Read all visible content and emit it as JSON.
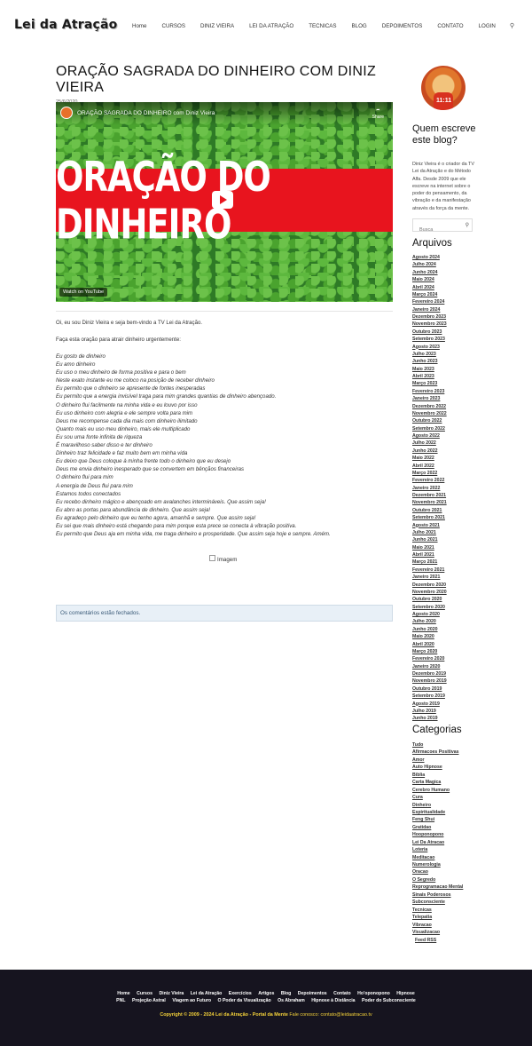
{
  "header": {
    "logo": "Lei da Atração",
    "nav": [
      "Home",
      "CURSOS",
      "DINIZ VIEIRA",
      "LEI DA ATRAÇÃO",
      "TECNICAS",
      "BLOG",
      "DEPOIMENTOS",
      "CONTATO",
      "LOGIN"
    ],
    "search_icon": "search-icon"
  },
  "post": {
    "title": "ORAÇÃO SAGRADA DO DINHEIRO COM DINIZ VIEIRA",
    "date": "25/6/2020",
    "video": {
      "title": "ORAÇÃO SAGRADA DO DINHEIRO com Diniz Vieira",
      "share": "Share",
      "banner": "ORAÇÃO DO DINHEIRO",
      "watch_on": "Watch on YouTube"
    },
    "intro1": "Oi, eu sou Diniz Vieira e seja bem-vindo a TV Lei da Atração.",
    "intro2": "Faça esta oração para atrair dinheiro urgentemente:",
    "prayer": [
      "Eu gosto de dinheiro",
      "Eu amo dinheiro",
      "Eu uso o meu dinheiro de forma positiva e para o bem",
      "Neste exato instante eu me coloco na posição de receber dinheiro",
      "Eu permito que o dinheiro se apresente de fontes inesperadas",
      "Eu permito que a energia invisível traga para mim grandes quantias de dinheiro abençoado.",
      "O dinheiro flui facilmente na minha vida e eu louvo por isso",
      "Eu uso dinheiro com alegria e ele sempre volta para mim",
      "Deus me recompense cada dia mais com dinheiro ilimitado",
      "Quanto mais eu uso meu dinheiro, mais ele multiplicado",
      "Eu sou uma fonte infinita de riqueza",
      "É maravilhoso saber disso e ter dinheiro",
      "Dinheiro traz felicidade e faz muito bem em minha vida",
      "Eu deixo que Deus coloque à minha frente todo o dinheiro que eu desejo",
      "Deus me envia dinheiro inesperado que se convertem em bênçãos financeiras",
      "O dinheiro flui para mim",
      "A energia de Deus flui para mim",
      "Estamos todos conectados",
      "Eu recebo dinheiro mágico e abençoado em avalanches intermináveis. Que assim seja!",
      "Eu abro as portas para abundância de dinheiro. Que assim seja!",
      "Eu agradeço pelo dinheiro que eu tenho agora, amanhã e sempre. Que assim seja!",
      "Eu sei que mais dinheiro está chegando para mim porque esta prece se conecta à vibração positiva.",
      "Eu permito que Deus aja em minha vida, me traga dinheiro e prosperidade. Que assim seja hoje e sempre. Amém."
    ],
    "image_alt": "Imagem",
    "comments_closed": "Os comentários estão fechados."
  },
  "sidebar": {
    "avatar_text": "11:11",
    "who_title": "Quem escreve este blog?",
    "who_desc": "Diniz Vieira é o criador da TV Lei da Atração e do Método Alfa. Desde 2009 que ele escreve na internet sobre o poder do pensamento, da vibração e da manifestação através da força da mente.",
    "search_placeholder": "Busca",
    "archives_title": "Arquivos",
    "archives": [
      "Agosto 2024",
      "Julho 2024",
      "Junho 2024",
      "Maio 2024",
      "Abril 2024",
      "Março 2024",
      "Fevereiro 2024",
      "Janeiro 2024",
      "Dezembro 2023",
      "Novembro 2023",
      "Outubro 2023",
      "Setembro 2023",
      "Agosto 2023",
      "Julho 2023",
      "Junho 2023",
      "Maio 2023",
      "Abril 2023",
      "Março 2023",
      "Fevereiro 2023",
      "Janeiro 2023",
      "Dezembro 2022",
      "Novembro 2022",
      "Outubro 2022",
      "Setembro 2022",
      "Agosto 2022",
      "Julho 2022",
      "Junho 2022",
      "Maio 2022",
      "Abril 2022",
      "Março 2022",
      "Fevereiro 2022",
      "Janeiro 2022",
      "Dezembro 2021",
      "Novembro 2021",
      "Outubro 2021",
      "Setembro 2021",
      "Agosto 2021",
      "Julho 2021",
      "Junho 2021",
      "Maio 2021",
      "Abril 2021",
      "Março 2021",
      "Fevereiro 2021",
      "Janeiro 2021",
      "Dezembro 2020",
      "Novembro 2020",
      "Outubro 2020",
      "Setembro 2020",
      "Agosto 2020",
      "Julho 2020",
      "Junho 2020",
      "Maio 2020",
      "Abril 2020",
      "Março 2020",
      "Fevereiro 2020",
      "Janeiro 2020",
      "Dezembro 2019",
      "Novembro 2019",
      "Outubro 2019",
      "Setembro 2019",
      "Agosto 2019",
      "Julho 2019",
      "Junho 2019"
    ],
    "categories_title": "Categorias",
    "categories": [
      "Tudo",
      "Afirmacoes Positivas",
      "Amor",
      "Auto Hipnose",
      "Biblia",
      "Carta Magica",
      "Cerebro Humano",
      "Cura",
      "Dinheiro",
      "Espiritualidade",
      "Feng Shui",
      "Gratidao",
      "Hooponopono",
      "Lei Da Atracao",
      "Loteria",
      "Meditacao",
      "Numerologia",
      "Oracao",
      "O Segredo",
      "Reprogramacao Mental",
      "Sinais Poderosos",
      "Subconsciente",
      "Tecnicas",
      "Telepatia",
      "Vibracao",
      "Visualizacao"
    ],
    "feed_rss": "Feed RSS"
  },
  "footer": {
    "row1": [
      "Home",
      "Cursos",
      "Diniz Vieira",
      "Lei da Atração",
      "Exercícios",
      "Artigos",
      "Blog",
      "Depoimentos",
      "Contato",
      "Ho'oponopono",
      "Hipnose"
    ],
    "row2": [
      "PNL",
      "Projeção Astral",
      "Viagem ao Futuro",
      "O Poder da Visualização",
      "Os Abraham",
      "Hipnose à Distância",
      "Poder do Subconsciente"
    ],
    "copyright": "Copyright © 2009 - 2024 Lei da Atração - Portal da Mente",
    "contact_label": "Fale conosco:",
    "contact_email": "contato@leidaatracao.tv"
  }
}
